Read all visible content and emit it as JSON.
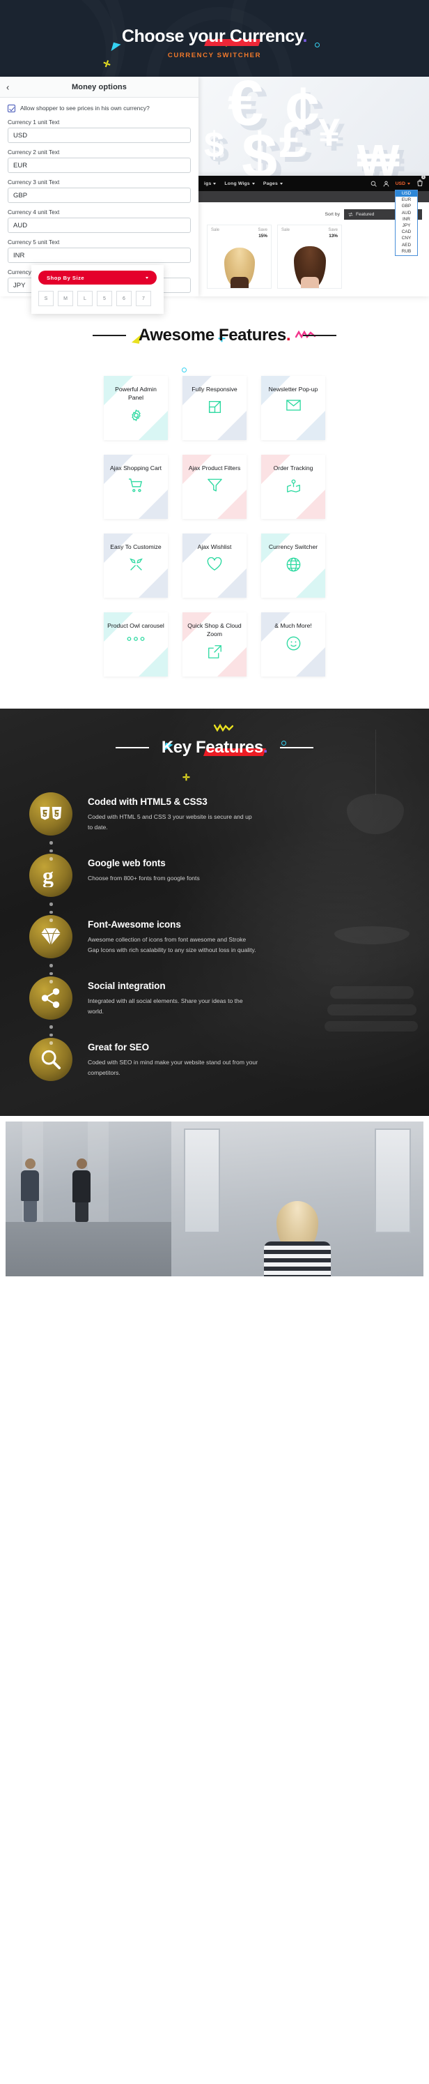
{
  "hero": {
    "title": "Choose your Currency",
    "title_dot": ".",
    "subtitle": "CURRENCY SWITCHER"
  },
  "admin_panel": {
    "back_icon": "chevron-left-icon",
    "title": "Money options",
    "checkbox": {
      "checked": true,
      "label": "Allow shopper to see prices in his own currency?"
    },
    "fields": [
      {
        "label": "Currency 1 unit Text",
        "value": "USD"
      },
      {
        "label": "Currency 2 unit Text",
        "value": "EUR"
      },
      {
        "label": "Currency 3 unit Text",
        "value": "GBP"
      },
      {
        "label": "Currency 4 unit Text",
        "value": "AUD"
      },
      {
        "label": "Currency 5 unit Text",
        "value": "INR"
      },
      {
        "label": "Currency 6 unit Text",
        "value": "JPY"
      }
    ]
  },
  "money_art": {
    "symbols": [
      "€",
      "¢",
      "£",
      "¥",
      "$",
      "$",
      "₩"
    ]
  },
  "store_preview": {
    "nav": {
      "items": [
        {
          "label": "igs",
          "caret": true
        },
        {
          "label": "Long Wigs",
          "caret": true
        },
        {
          "label": "Pages",
          "caret": true
        }
      ],
      "search_icon": "search-icon",
      "account_icon": "user-icon",
      "currency_label": "USD",
      "cart_icon": "shopping-bag-icon",
      "cart_count": "1"
    },
    "currency_dropdown": {
      "selected": "USD",
      "options": [
        "USD",
        "EUR",
        "GBP",
        "AUD",
        "INR",
        "JPY",
        "CAD",
        "CNY",
        "AED",
        "RUB"
      ]
    },
    "sort": {
      "label": "Sort by",
      "icon": "sort-icon",
      "value": "Featured"
    },
    "products": [
      {
        "badge_left": "Sale",
        "badge_right_label": "Save",
        "badge_right_value": "15%",
        "hair": "blonde"
      },
      {
        "badge_left": "Sale",
        "badge_right_label": "Save",
        "badge_right_value": "13%",
        "hair": "brown"
      }
    ]
  },
  "size_widget": {
    "button_label": "Shop By Size",
    "caret_icon": "chevron-down-icon",
    "sizes": [
      "S",
      "M",
      "L",
      "5",
      "6",
      "7"
    ]
  },
  "awesome_features": {
    "heading": "Awesome Features",
    "heading_dot": ".",
    "cards": [
      {
        "title": "Powerful Admin Panel",
        "icon": "gear-icon",
        "corner": "#d9f6f4"
      },
      {
        "title": "Fully Responsive",
        "icon": "expand-icon",
        "corner": "#e3e9f2"
      },
      {
        "title": "Newsletter Pop-up",
        "icon": "envelope-icon",
        "corner": "#e2ecf5"
      },
      {
        "title": "Ajax Shopping Cart",
        "icon": "shopping-cart-icon",
        "corner": "#e3e9f2"
      },
      {
        "title": "Ajax Product Filters",
        "icon": "funnel-icon",
        "corner": "#fbe2e4"
      },
      {
        "title": "Order Tracking",
        "icon": "map-pin-icon",
        "corner": "#fbe2e4"
      },
      {
        "title": "Easy To Customize",
        "icon": "tools-icon",
        "corner": "#e3e9f2"
      },
      {
        "title": "Ajax Wishlist",
        "icon": "heart-icon",
        "corner": "#e3e9f2"
      },
      {
        "title": "Currency Switcher",
        "icon": "globe-icon",
        "corner": "#d9f6f4"
      },
      {
        "title": "Product Owl carousel",
        "icon": "dots-icon",
        "corner": "#d9f6f4"
      },
      {
        "title": "Quick Shop & Cloud Zoom",
        "icon": "share-square-icon",
        "corner": "#fbe2e4"
      },
      {
        "title": "& Much More!",
        "icon": "smiley-icon",
        "corner": "#e3e9f2"
      }
    ]
  },
  "key_features": {
    "heading": "Key Features",
    "heading_dot": ".",
    "items": [
      {
        "icon": "html5-css3-icon",
        "title": "Coded with HTML5 & CSS3",
        "desc": "Coded with HTML 5 and CSS 3 your website is secure and up to date."
      },
      {
        "icon": "google-fonts-icon",
        "title": "Google web fonts",
        "desc": "Choose from 800+ fonts from google fonts"
      },
      {
        "icon": "diamond-icon",
        "title": "Font-Awesome icons",
        "desc": "Awesome collection of icons from font awesome and Stroke Gap Icons with rich scalability to any size without loss in quality."
      },
      {
        "icon": "share-nodes-icon",
        "title": "Social integration",
        "desc": "Integrated with all social elements. Share your ideas to the world."
      },
      {
        "icon": "search-icon",
        "title": "Great for SEO",
        "desc": "Coded with SEO in mind make your website stand out from your competitors."
      }
    ]
  },
  "colors": {
    "hero_bg": "#1b2430",
    "accent_red": "#e4002b",
    "accent_orange": "#f2792a",
    "accent_cyan": "#35d2f2",
    "accent_yellow": "#e9e120",
    "accent_purple": "#9b8df0",
    "accent_pink": "#f2348c",
    "icon_teal": "#2bd9a0",
    "gold": "#c2a336",
    "dark_section": "#1c1c1c"
  }
}
